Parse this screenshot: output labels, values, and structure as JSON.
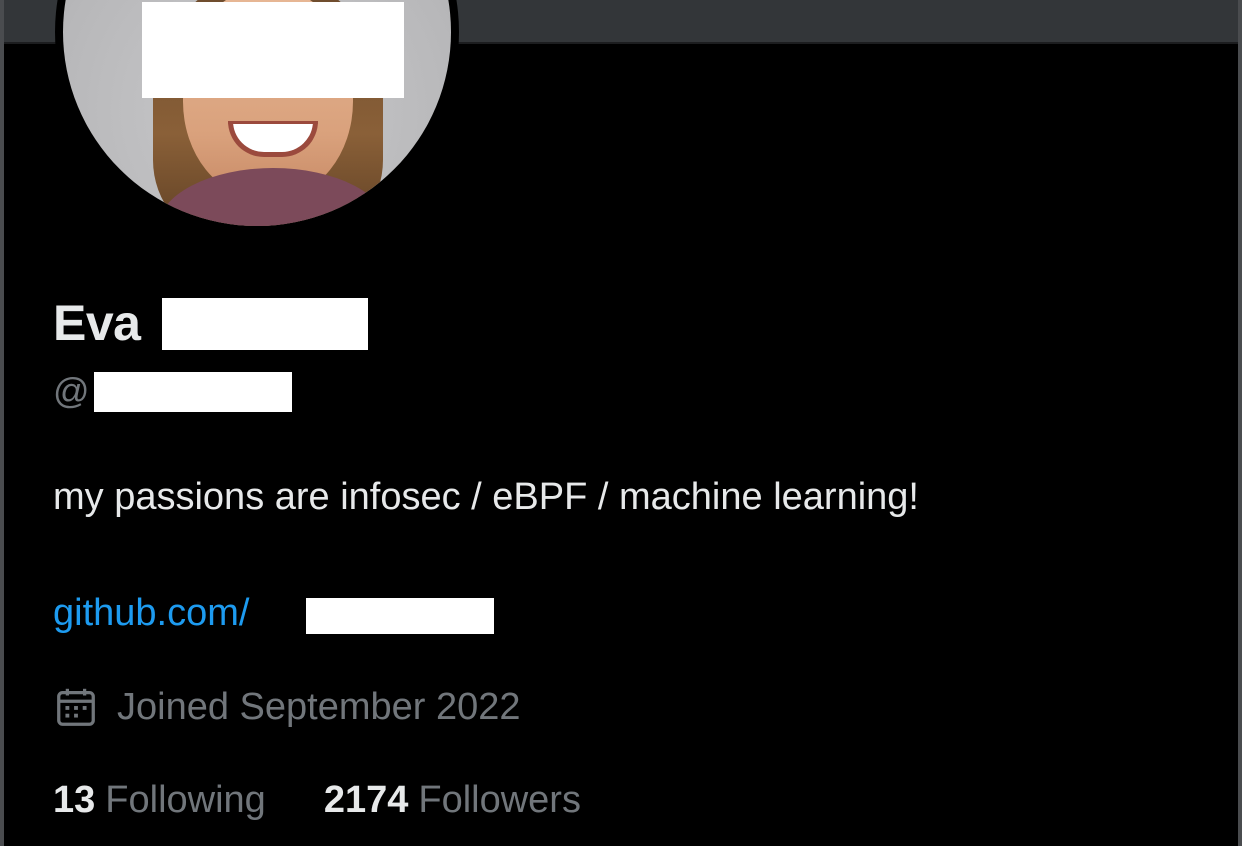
{
  "profile": {
    "display_name": "Eva",
    "handle_prefix": "@",
    "bio": "my passions are infosec / eBPF / machine learning!",
    "link_text": "github.com/",
    "joined": "Joined September 2022",
    "joined_icon": "calendar-icon",
    "avatar_icon": "profile-photo"
  },
  "stats": {
    "following_count": "13",
    "following_label": "Following",
    "followers_count": "2174",
    "followers_label": "Followers"
  },
  "colors": {
    "background": "#000000",
    "text_primary": "#e7e9ea",
    "text_secondary": "#71767b",
    "link": "#1d9bf0",
    "banner": "#333639"
  }
}
